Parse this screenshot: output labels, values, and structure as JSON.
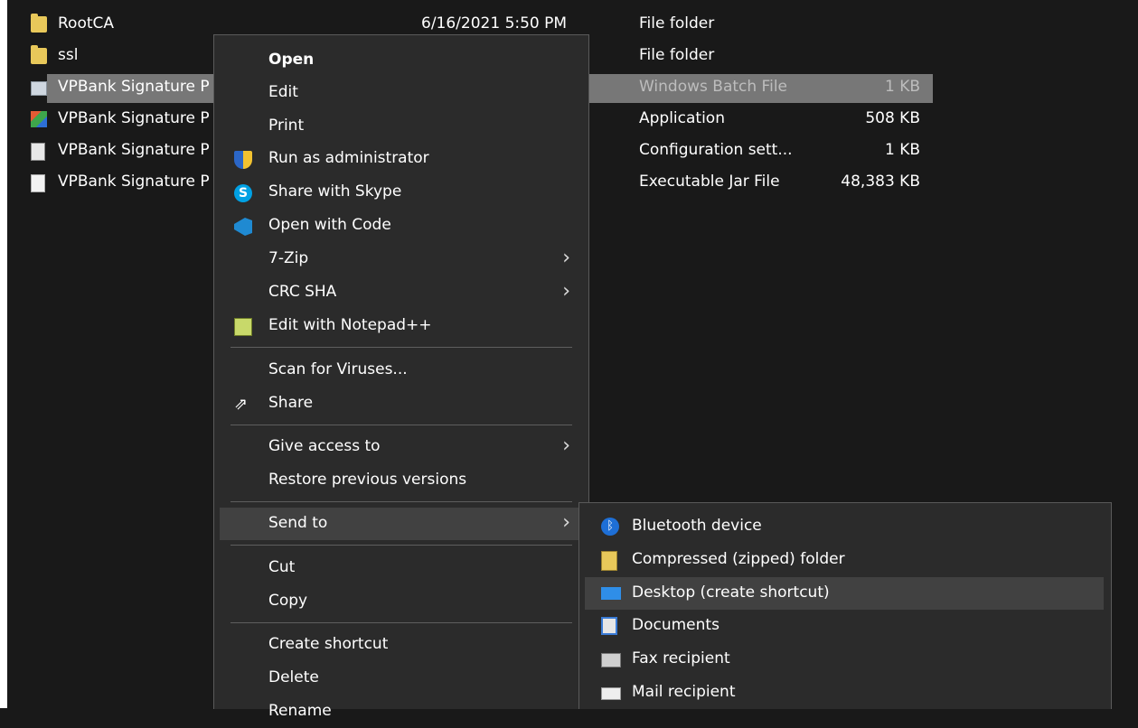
{
  "files": [
    {
      "name": "RootCA",
      "date": "6/16/2021 5:50 PM",
      "type": "File folder",
      "size": "",
      "icon": "folder-icon"
    },
    {
      "name": "ssl",
      "date": "",
      "type": "File folder",
      "size": "",
      "icon": "folder-icon"
    },
    {
      "name": "VPBank Signature P",
      "date": "",
      "type": "Windows Batch File",
      "size": "1 KB",
      "icon": "batch-file-icon"
    },
    {
      "name": "VPBank Signature P",
      "date": "",
      "type": "Application",
      "size": "508 KB",
      "icon": "application-icon"
    },
    {
      "name": "VPBank Signature P",
      "date": "",
      "type": "Configuration sett...",
      "size": "1 KB",
      "icon": "config-file-icon"
    },
    {
      "name": "VPBank Signature P",
      "date": "",
      "type": "Executable Jar File",
      "size": "48,383 KB",
      "icon": "jar-file-icon"
    }
  ],
  "context_menu": {
    "open": "Open",
    "edit": "Edit",
    "print": "Print",
    "run_as_admin": "Run as administrator",
    "share_skype": "Share with Skype",
    "open_with_code": "Open with Code",
    "seven_zip": "7-Zip",
    "crc_sha": "CRC SHA",
    "edit_notepadpp": "Edit with Notepad++",
    "scan_viruses": "Scan for Viruses...",
    "share": "Share",
    "give_access": "Give access to",
    "restore_versions": "Restore previous versions",
    "send_to": "Send to",
    "cut": "Cut",
    "copy": "Copy",
    "create_shortcut": "Create shortcut",
    "delete": "Delete",
    "rename": "Rename"
  },
  "send_to_menu": {
    "bluetooth": "Bluetooth device",
    "compressed": "Compressed (zipped) folder",
    "desktop": "Desktop (create shortcut)",
    "documents": "Documents",
    "fax": "Fax recipient",
    "mail": "Mail recipient"
  },
  "icons": {
    "chevron": "›",
    "share_glyph": "⇗",
    "bluetooth_glyph": "ᛒ",
    "skype_glyph": "S"
  },
  "colors": {
    "background": "#191919",
    "menu_background": "#2b2b2b",
    "hover": "#414141",
    "selection": "#777777"
  }
}
